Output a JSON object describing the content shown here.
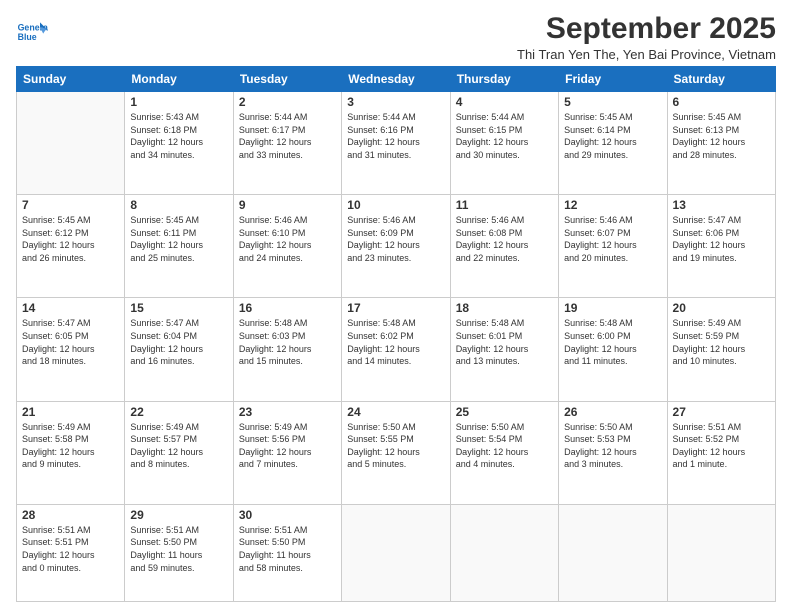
{
  "logo": {
    "line1": "General",
    "line2": "Blue"
  },
  "title": "September 2025",
  "subtitle": "Thi Tran Yen The, Yen Bai Province, Vietnam",
  "headers": [
    "Sunday",
    "Monday",
    "Tuesday",
    "Wednesday",
    "Thursday",
    "Friday",
    "Saturday"
  ],
  "weeks": [
    [
      {
        "day": "",
        "info": ""
      },
      {
        "day": "1",
        "info": "Sunrise: 5:43 AM\nSunset: 6:18 PM\nDaylight: 12 hours\nand 34 minutes."
      },
      {
        "day": "2",
        "info": "Sunrise: 5:44 AM\nSunset: 6:17 PM\nDaylight: 12 hours\nand 33 minutes."
      },
      {
        "day": "3",
        "info": "Sunrise: 5:44 AM\nSunset: 6:16 PM\nDaylight: 12 hours\nand 31 minutes."
      },
      {
        "day": "4",
        "info": "Sunrise: 5:44 AM\nSunset: 6:15 PM\nDaylight: 12 hours\nand 30 minutes."
      },
      {
        "day": "5",
        "info": "Sunrise: 5:45 AM\nSunset: 6:14 PM\nDaylight: 12 hours\nand 29 minutes."
      },
      {
        "day": "6",
        "info": "Sunrise: 5:45 AM\nSunset: 6:13 PM\nDaylight: 12 hours\nand 28 minutes."
      }
    ],
    [
      {
        "day": "7",
        "info": "Sunrise: 5:45 AM\nSunset: 6:12 PM\nDaylight: 12 hours\nand 26 minutes."
      },
      {
        "day": "8",
        "info": "Sunrise: 5:45 AM\nSunset: 6:11 PM\nDaylight: 12 hours\nand 25 minutes."
      },
      {
        "day": "9",
        "info": "Sunrise: 5:46 AM\nSunset: 6:10 PM\nDaylight: 12 hours\nand 24 minutes."
      },
      {
        "day": "10",
        "info": "Sunrise: 5:46 AM\nSunset: 6:09 PM\nDaylight: 12 hours\nand 23 minutes."
      },
      {
        "day": "11",
        "info": "Sunrise: 5:46 AM\nSunset: 6:08 PM\nDaylight: 12 hours\nand 22 minutes."
      },
      {
        "day": "12",
        "info": "Sunrise: 5:46 AM\nSunset: 6:07 PM\nDaylight: 12 hours\nand 20 minutes."
      },
      {
        "day": "13",
        "info": "Sunrise: 5:47 AM\nSunset: 6:06 PM\nDaylight: 12 hours\nand 19 minutes."
      }
    ],
    [
      {
        "day": "14",
        "info": "Sunrise: 5:47 AM\nSunset: 6:05 PM\nDaylight: 12 hours\nand 18 minutes."
      },
      {
        "day": "15",
        "info": "Sunrise: 5:47 AM\nSunset: 6:04 PM\nDaylight: 12 hours\nand 16 minutes."
      },
      {
        "day": "16",
        "info": "Sunrise: 5:48 AM\nSunset: 6:03 PM\nDaylight: 12 hours\nand 15 minutes."
      },
      {
        "day": "17",
        "info": "Sunrise: 5:48 AM\nSunset: 6:02 PM\nDaylight: 12 hours\nand 14 minutes."
      },
      {
        "day": "18",
        "info": "Sunrise: 5:48 AM\nSunset: 6:01 PM\nDaylight: 12 hours\nand 13 minutes."
      },
      {
        "day": "19",
        "info": "Sunrise: 5:48 AM\nSunset: 6:00 PM\nDaylight: 12 hours\nand 11 minutes."
      },
      {
        "day": "20",
        "info": "Sunrise: 5:49 AM\nSunset: 5:59 PM\nDaylight: 12 hours\nand 10 minutes."
      }
    ],
    [
      {
        "day": "21",
        "info": "Sunrise: 5:49 AM\nSunset: 5:58 PM\nDaylight: 12 hours\nand 9 minutes."
      },
      {
        "day": "22",
        "info": "Sunrise: 5:49 AM\nSunset: 5:57 PM\nDaylight: 12 hours\nand 8 minutes."
      },
      {
        "day": "23",
        "info": "Sunrise: 5:49 AM\nSunset: 5:56 PM\nDaylight: 12 hours\nand 7 minutes."
      },
      {
        "day": "24",
        "info": "Sunrise: 5:50 AM\nSunset: 5:55 PM\nDaylight: 12 hours\nand 5 minutes."
      },
      {
        "day": "25",
        "info": "Sunrise: 5:50 AM\nSunset: 5:54 PM\nDaylight: 12 hours\nand 4 minutes."
      },
      {
        "day": "26",
        "info": "Sunrise: 5:50 AM\nSunset: 5:53 PM\nDaylight: 12 hours\nand 3 minutes."
      },
      {
        "day": "27",
        "info": "Sunrise: 5:51 AM\nSunset: 5:52 PM\nDaylight: 12 hours\nand 1 minute."
      }
    ],
    [
      {
        "day": "28",
        "info": "Sunrise: 5:51 AM\nSunset: 5:51 PM\nDaylight: 12 hours\nand 0 minutes."
      },
      {
        "day": "29",
        "info": "Sunrise: 5:51 AM\nSunset: 5:50 PM\nDaylight: 11 hours\nand 59 minutes."
      },
      {
        "day": "30",
        "info": "Sunrise: 5:51 AM\nSunset: 5:50 PM\nDaylight: 11 hours\nand 58 minutes."
      },
      {
        "day": "",
        "info": ""
      },
      {
        "day": "",
        "info": ""
      },
      {
        "day": "",
        "info": ""
      },
      {
        "day": "",
        "info": ""
      }
    ]
  ]
}
